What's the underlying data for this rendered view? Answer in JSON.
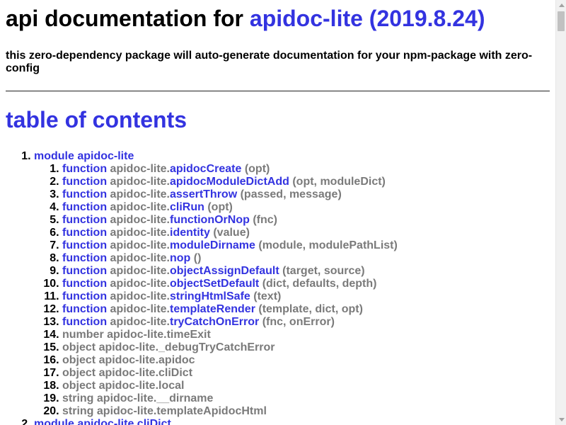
{
  "header": {
    "title_prefix": "api documentation for",
    "title_package": "apidoc-lite (2019.8.24)",
    "description": "this zero-dependency package will auto-generate documentation for your npm-package with zero-config"
  },
  "toc": {
    "heading": "table of contents",
    "modules": [
      {
        "label": "module apidoc-lite",
        "items": [
          {
            "kind": "function",
            "prefix": "apidoc-lite.",
            "name": "apidocCreate",
            "sig": "(opt)"
          },
          {
            "kind": "function",
            "prefix": "apidoc-lite.",
            "name": "apidocModuleDictAdd",
            "sig": "(opt, moduleDict)"
          },
          {
            "kind": "function",
            "prefix": "apidoc-lite.",
            "name": "assertThrow",
            "sig": "(passed, message)"
          },
          {
            "kind": "function",
            "prefix": "apidoc-lite.",
            "name": "cliRun",
            "sig": "(opt)"
          },
          {
            "kind": "function",
            "prefix": "apidoc-lite.",
            "name": "functionOrNop",
            "sig": "(fnc)"
          },
          {
            "kind": "function",
            "prefix": "apidoc-lite.",
            "name": "identity",
            "sig": "(value)"
          },
          {
            "kind": "function",
            "prefix": "apidoc-lite.",
            "name": "moduleDirname",
            "sig": "(module, modulePathList)"
          },
          {
            "kind": "function",
            "prefix": "apidoc-lite.",
            "name": "nop",
            "sig": "()"
          },
          {
            "kind": "function",
            "prefix": "apidoc-lite.",
            "name": "objectAssignDefault",
            "sig": "(target, source)"
          },
          {
            "kind": "function",
            "prefix": "apidoc-lite.",
            "name": "objectSetDefault",
            "sig": "(dict, defaults, depth)"
          },
          {
            "kind": "function",
            "prefix": "apidoc-lite.",
            "name": "stringHtmlSafe",
            "sig": "(text)"
          },
          {
            "kind": "function",
            "prefix": "apidoc-lite.",
            "name": "templateRender",
            "sig": "(template, dict, opt)"
          },
          {
            "kind": "function",
            "prefix": "apidoc-lite.",
            "name": "tryCatchOnError",
            "sig": "(fnc, onError)"
          },
          {
            "kind": "property",
            "text": "number apidoc-lite.timeExit"
          },
          {
            "kind": "property",
            "text": "object apidoc-lite._debugTryCatchError"
          },
          {
            "kind": "property",
            "text": "object apidoc-lite.apidoc"
          },
          {
            "kind": "property",
            "text": "object apidoc-lite.cliDict"
          },
          {
            "kind": "property",
            "text": "object apidoc-lite.local"
          },
          {
            "kind": "property",
            "text": "string apidoc-lite.__dirname"
          },
          {
            "kind": "property",
            "text": "string apidoc-lite.templateApidocHtml"
          }
        ]
      },
      {
        "label": "module apidoc-lite.cliDict",
        "items": []
      }
    ]
  },
  "colors": {
    "link": "#3333e0",
    "muted": "#7a7a7a",
    "text": "#000000"
  }
}
